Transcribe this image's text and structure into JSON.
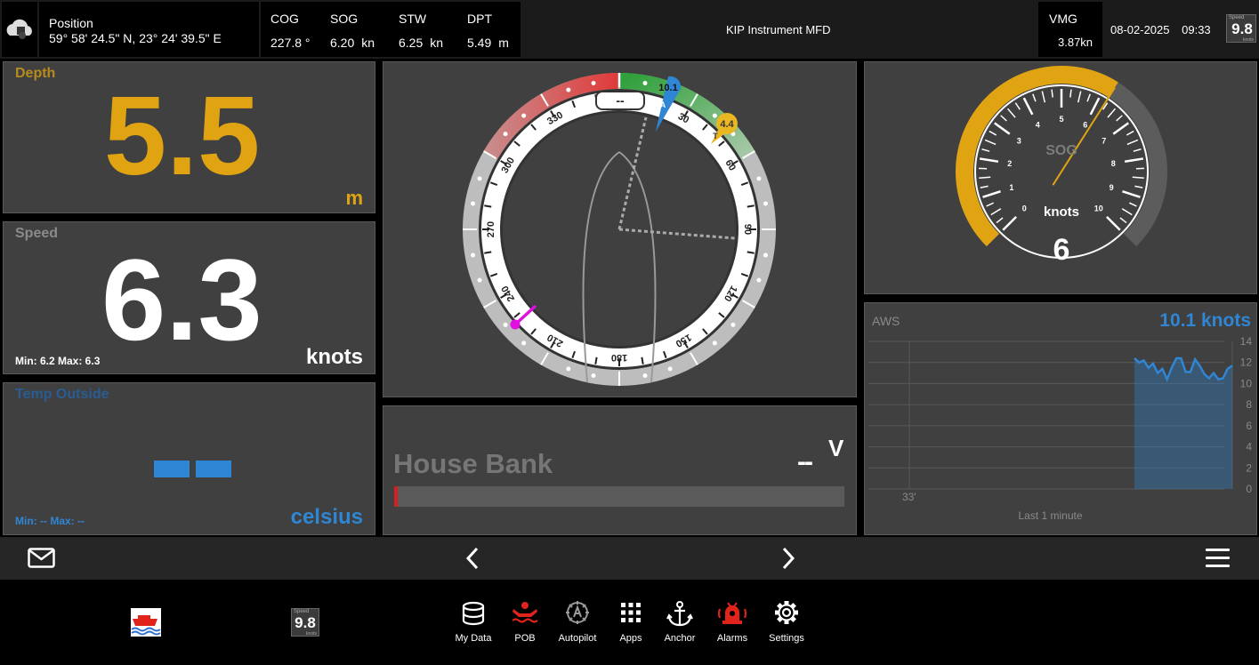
{
  "topbar": {
    "position_label": "Position",
    "position_value": "59° 58' 24.5\" N, 23° 24' 39.5\" E",
    "cog_label": "COG",
    "cog_value": "227.8 °",
    "sog_label": "SOG",
    "sog_value": "6.20",
    "sog_unit": "kn",
    "stw_label": "STW",
    "stw_value": "6.25",
    "stw_unit": "kn",
    "dpt_label": "DPT",
    "dpt_value": "5.49",
    "dpt_unit": "m",
    "app_title": "KIP Instrument MFD",
    "vmg_label": "VMG",
    "vmg_value": "3.87kn",
    "date": "08-02-2025",
    "time": "09:33",
    "speed_badge_title": "Speed",
    "speed_badge_value": "9.8",
    "speed_badge_unit": "knots"
  },
  "depth": {
    "title": "Depth",
    "value": "5.5",
    "unit": "m",
    "color": "#e0a412"
  },
  "speed": {
    "title": "Speed",
    "value": "6.3",
    "unit": "knots",
    "minmax": "Min: 6.2 Max: 6.3"
  },
  "temp": {
    "title": "Temp Outside",
    "value": "--",
    "unit": "celsius",
    "minmax": "Min: -- Max: --",
    "color": "#2f86d4"
  },
  "compass": {
    "heading_display": "--",
    "ticks": [
      "30",
      "60",
      "90",
      "120",
      "150",
      "180",
      "210",
      "240",
      "270",
      "300",
      "330"
    ],
    "aws_marker": "10.1",
    "aws_marker_letter": "A",
    "tws_marker": "4.4",
    "tws_marker_letter": "T"
  },
  "battery": {
    "title": "House Bank",
    "value": "--",
    "unit": "V",
    "fill_fraction": 0.004
  },
  "sog_gauge": {
    "label": "SOG",
    "unit": "knots",
    "value": "6",
    "scale": [
      "0",
      "1",
      "2",
      "3",
      "4",
      "5",
      "6",
      "7",
      "8",
      "9",
      "10"
    ],
    "needle_value": 6.2,
    "max": 10
  },
  "aws_chart": {
    "title": "AWS",
    "current": "10.1 knots",
    "y_ticks": [
      "14",
      "12",
      "10",
      "8",
      "6",
      "4",
      "2",
      "0"
    ],
    "x_tick": "33'",
    "footer": "Last 1 minute"
  },
  "chart_data": {
    "type": "area",
    "title": "AWS",
    "xlabel": "Last 1 minute",
    "ylim": [
      0,
      14
    ],
    "series": [
      {
        "name": "AWS",
        "values": [
          12.4,
          12.0,
          12.2,
          11.5,
          11.9,
          11.0,
          11.4,
          10.4,
          11.5,
          12.4,
          12.4,
          11.1,
          11.1,
          12.3,
          11.7,
          10.9,
          10.5,
          11.0,
          10.4,
          10.5,
          11.4,
          11.7
        ]
      }
    ]
  },
  "nav": {
    "mail_icon": "mail-icon",
    "prev_icon": "chevron-left-icon",
    "next_icon": "chevron-right-icon",
    "menu_icon": "menu-icon"
  },
  "dock": {
    "items": [
      {
        "label": "My Data"
      },
      {
        "label": "POB"
      },
      {
        "label": "Autopilot"
      },
      {
        "label": "Apps"
      },
      {
        "label": "Anchor"
      },
      {
        "label": "Alarms"
      },
      {
        "label": "Settings"
      }
    ],
    "speed_badge_title": "Speed",
    "speed_badge_value": "9.8",
    "speed_badge_unit": "knots"
  },
  "colors": {
    "accent_yellow": "#e0a412",
    "accent_blue": "#2f86d4",
    "pob_red": "#e0231b",
    "panel": "#404040"
  }
}
